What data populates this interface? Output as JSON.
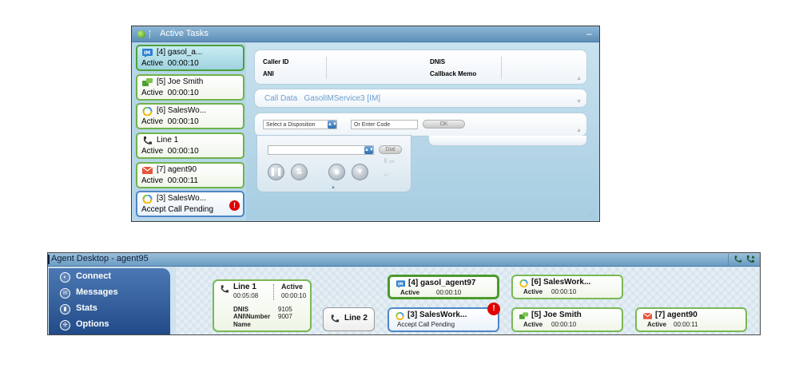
{
  "active_tasks": {
    "title": "Active Tasks",
    "minimize": "–",
    "tasks": [
      {
        "icon": "im-icon",
        "name": "[4] gasol_a...",
        "status": "Active",
        "time": "00:00:10"
      },
      {
        "icon": "chat-icon",
        "name": "[5] Joe Smith",
        "status": "Active",
        "time": "00:00:10"
      },
      {
        "icon": "salesforce-icon",
        "name": "[6] SalesWo...",
        "status": "Active",
        "time": "00:00:10"
      },
      {
        "icon": "phone-icon",
        "name": "Line 1",
        "status": "Active",
        "time": "00:00:10"
      },
      {
        "icon": "email-icon",
        "name": "[7] agent90",
        "status": "Active",
        "time": "00:00:11"
      },
      {
        "icon": "salesforce-icon",
        "name": "[3] SalesWo...",
        "status": "Accept Call Pending",
        "time": "",
        "alert": "!"
      }
    ],
    "details": {
      "caller_id": "Caller ID",
      "ani": "ANI",
      "dnis": "DNIS",
      "callback_memo": "Callback Memo",
      "call_data_label": "Call Data",
      "call_data_value": "GasolIMService3 [IM]",
      "disposition_placeholder": "Select a Disposition",
      "code_placeholder": "Or Enter Code",
      "ok_label": "OK",
      "dial_label": "Dial"
    }
  },
  "agent_desktop": {
    "title": "Agent Desktop - agent95",
    "nav": [
      {
        "label": "Connect",
        "icon": "connect-icon"
      },
      {
        "label": "Messages",
        "icon": "messages-icon"
      },
      {
        "label": "Stats",
        "icon": "stats-icon"
      },
      {
        "label": "Options",
        "icon": "options-icon"
      }
    ],
    "line1": {
      "name": "Line 1",
      "duration": "00:05:08",
      "status": "Active",
      "time": "00:00:10",
      "dnis_label": "DNIS",
      "dnis_value": "9105",
      "ani_label": "ANI\\Number",
      "ani_value": "9007",
      "name_label": "Name"
    },
    "line2": {
      "name": "Line 2"
    },
    "cards": {
      "gasol": {
        "name": "[4] gasol_agent97",
        "status": "Active",
        "time": "00:00:10"
      },
      "sales3": {
        "name": "[3] SalesWork...",
        "status": "Accept Call Pending",
        "alert": "!"
      },
      "sales6": {
        "name": "[6] SalesWork...",
        "status": "Active",
        "time": "00:00:10"
      },
      "joe": {
        "name": "[5] Joe Smith",
        "status": "Active",
        "time": "00:00:10"
      },
      "agent90": {
        "name": "[7] agent90",
        "status": "Active",
        "time": "00:00:11"
      }
    }
  },
  "colors": {
    "accent_green": "#79b956",
    "pending_blue": "#4f86c6",
    "nav_blue": "#214b88",
    "alert_red": "#e00000"
  }
}
